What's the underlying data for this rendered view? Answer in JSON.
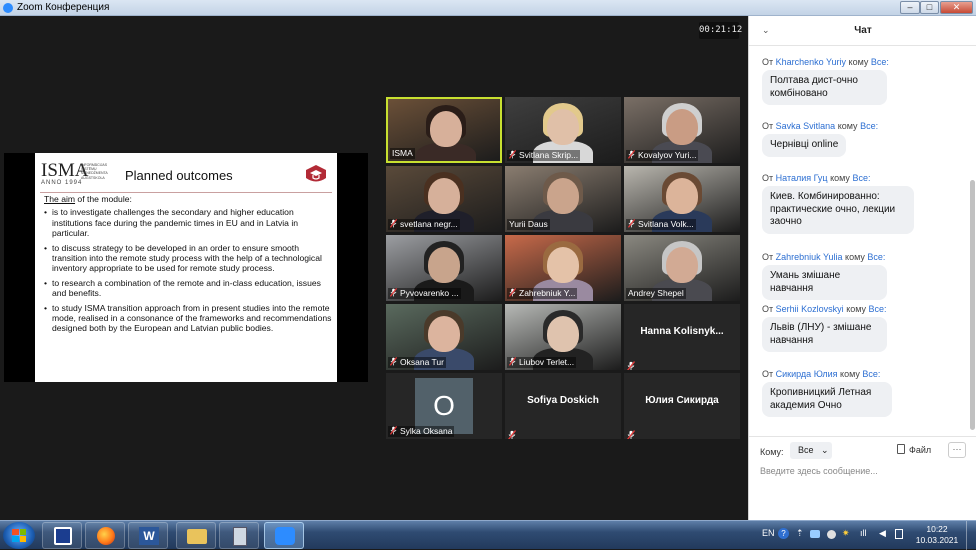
{
  "window": {
    "title": "Zoom Конференция",
    "min": "–",
    "max": "□",
    "close": "✕"
  },
  "meeting": {
    "timer": "00:21:12"
  },
  "slide": {
    "logo": "ISMA",
    "logo_sub": "INFORMĀCIJAS SISTĒMU MENEDŽMENTA AUGSTSKOLA",
    "logo_year": "ANNO 1994",
    "title": "Planned outcomes",
    "intro_underlined": "The aim",
    "intro_rest": " of the module:",
    "bullets": [
      "is to investigate challenges the secondary and higher education institutions face during the pandemic times in EU and in Latvia in particular.",
      "to discuss strategy to be developed in an order to ensure smooth transition into the remote study process with the help of a technological inventory appropriate to be used for remote study process.",
      "to research a combination of the remote and in-class education, issues and benefits.",
      "to study ISMA transition approach from in present studies into the remote mode, realised in a consonance of the frameworks and recommendations designed both by the European and Latvian public bodies."
    ]
  },
  "participants": [
    {
      "name": "ISMA",
      "muted": false,
      "bg": "#6b5038",
      "skin": "#d7b09a",
      "hair": "#2a1d18",
      "shirt": "#3a2a26",
      "active": true
    },
    {
      "name": "Svitlana Skrip...",
      "muted": true,
      "bg": "#3f3f3f",
      "skin": "#e0c0a8",
      "hair": "#e2c98c",
      "shirt": "#d8d8d8"
    },
    {
      "name": "Kovalyov Yuri...",
      "muted": true,
      "bg": "#7a6f66",
      "skin": "#c99c84",
      "hair": "#cfcfcf",
      "shirt": "#4a4a52"
    },
    {
      "name": "svetlana negr...",
      "muted": true,
      "bg": "#5a4a3a",
      "skin": "#d6b09a",
      "hair": "#4a3020",
      "shirt": "#1f1f2a"
    },
    {
      "name": "Yurii Daus",
      "muted": false,
      "bg": "#8a7d70",
      "skin": "#caa48c",
      "hair": "#6e5a4a",
      "shirt": "#3a3a40"
    },
    {
      "name": "Svitlana Volk...",
      "muted": true,
      "bg": "#b9b6ae",
      "skin": "#dcb49a",
      "hair": "#6a4a34",
      "shirt": "#2a3a5a"
    },
    {
      "name": "Pyvovarenko ...",
      "muted": true,
      "bg": "#9c9ea2",
      "skin": "#c8a48c",
      "hair": "#222",
      "shirt": "#1a1a1a"
    },
    {
      "name": "Zahrebniuk Y...",
      "muted": true,
      "bg": "#c86a4a",
      "skin": "#e4c2a8",
      "hair": "#9a6a40",
      "shirt": "#9a8aa0"
    },
    {
      "name": "Andrey Shepel",
      "muted": false,
      "bg": "#8a8880",
      "skin": "#d2aa94",
      "hair": "#c6c6c6",
      "shirt": "#4a4a50"
    },
    {
      "name": "Oksana Tur",
      "muted": true,
      "bg": "#5a6a5e",
      "skin": "#dcb49e",
      "hair": "#4a3a2a",
      "shirt": "#3a4a6a"
    },
    {
      "name": "Liubov Terlet...",
      "muted": true,
      "bg": "#b7b9b6",
      "skin": "#dfc3ae",
      "hair": "#2a2a2a",
      "shirt": "#222"
    },
    {
      "name": "Hanna  Kolisnyk...",
      "muted": true,
      "camoff": true
    },
    {
      "name": "Sylka Oksana",
      "muted": true,
      "avatar": "O"
    },
    {
      "name": "Sofiya Doskich",
      "muted": true,
      "camoff": true
    },
    {
      "name": "Юлия Сикирда",
      "muted": true,
      "camoff": true
    }
  ],
  "chat": {
    "header": "Чат",
    "from_word": "От",
    "to_word": "кому",
    "messages": [
      {
        "sender": "Kharchenko Yuriy",
        "recipient": "Все:",
        "text": "Полтава дист-очно комбіновано"
      },
      {
        "sender": "Savka Svitlana",
        "recipient": "Все:",
        "text": "Чернівці online"
      },
      {
        "sender": "Наталия Гуц",
        "recipient": "Все:",
        "text": "Киев. Комбинированно: практические очно, лекции заочно"
      },
      {
        "sender": "Zahrebniuk Yulia",
        "recipient": "Все:",
        "text": "Умань змішане навчання"
      },
      {
        "sender": "Serhii Kozlovskyi",
        "recipient": "Все:",
        "text": "Львів (ЛНУ) - змішане навчання"
      },
      {
        "sender": "Сикирда Юлия",
        "recipient": "Все:",
        "text": "Кропивницкий Летная академия Очно"
      }
    ],
    "to_label": "Кому:",
    "to_value": "Все",
    "file_label": "Файл",
    "more": "···",
    "input_placeholder": "Введите здесь сообщение..."
  },
  "taskbar": {
    "lang": "EN",
    "time": "10:22",
    "date": "10.03.2021"
  }
}
